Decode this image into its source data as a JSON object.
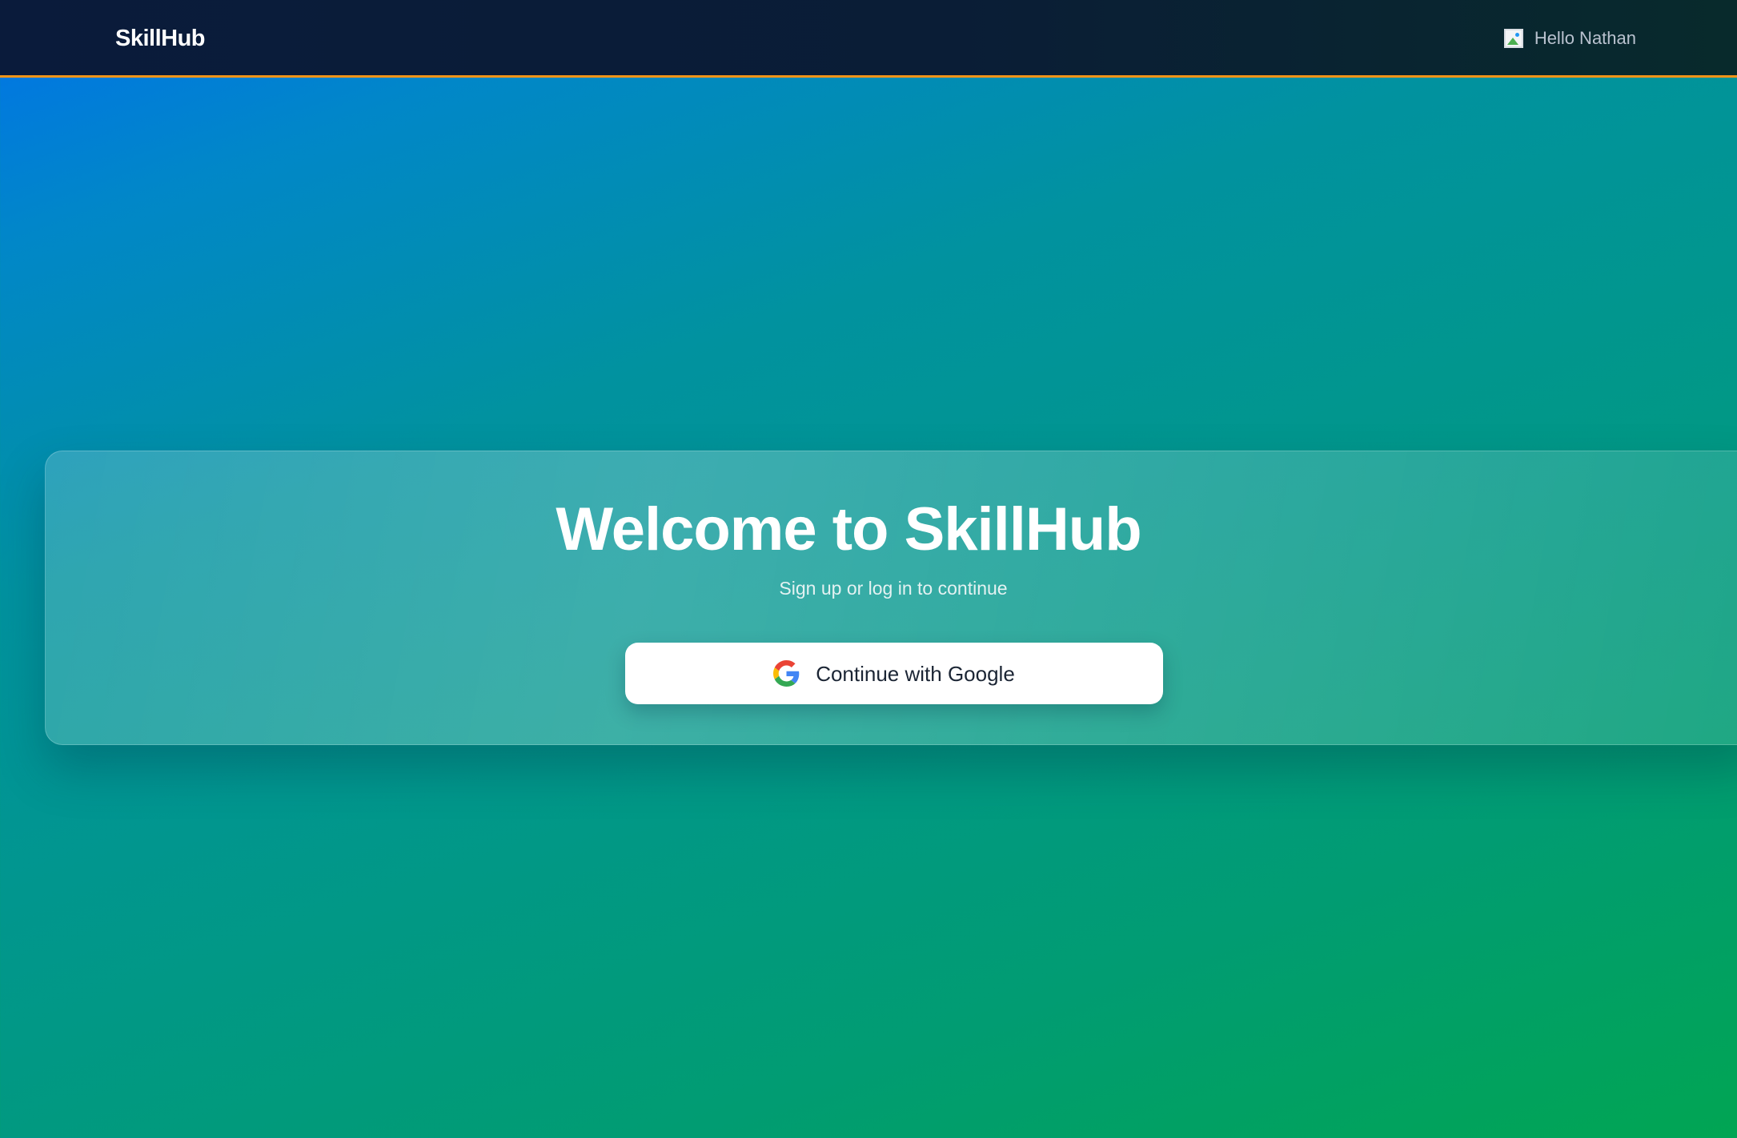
{
  "header": {
    "brand": "SkillHub",
    "greeting": "Hello Nathan",
    "accent_color": "#f39419"
  },
  "hero": {
    "title": "Welcome to SkillHub",
    "subtitle": "Sign up or log in to continue",
    "google_button_label": "Continue with Google",
    "google_icon": "google-g-icon"
  }
}
